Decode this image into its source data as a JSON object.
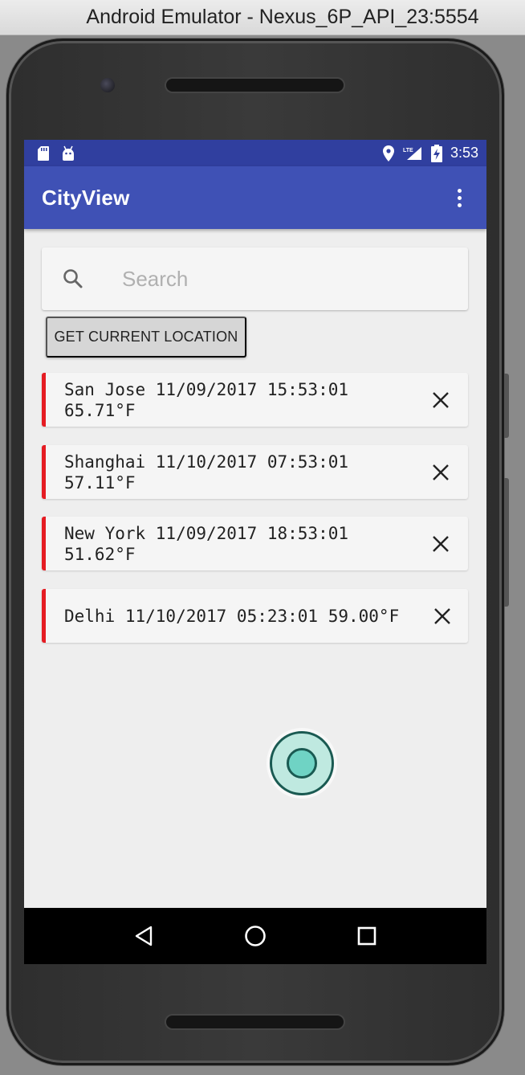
{
  "window": {
    "title": "Android Emulator - Nexus_6P_API_23:5554"
  },
  "statusbar": {
    "left_icons": [
      "sd-card-icon",
      "android-icon"
    ],
    "right_icons": [
      "location-icon",
      "lte-signal-icon",
      "battery-charging-icon"
    ],
    "time": "3:53",
    "color": "#303f9f"
  },
  "appbar": {
    "title": "CityView",
    "color": "#3f51b5",
    "menu_icon": "overflow-menu-icon"
  },
  "search": {
    "placeholder": "Search",
    "value": ""
  },
  "location_button": {
    "label": "GET CURRENT LOCATION"
  },
  "cities": [
    {
      "text": "San Jose 11/09/2017 15:53:01\n65.71°F"
    },
    {
      "text": "Shanghai 11/10/2017 07:53:01\n57.11°F"
    },
    {
      "text": "New York 11/09/2017 18:53:01\n51.62°F"
    },
    {
      "text": "Delhi 11/10/2017 05:23:01 59.00°F"
    }
  ],
  "card_accent_color": "#e51c23",
  "navbar": {
    "buttons": [
      "back-icon",
      "home-icon",
      "recents-icon"
    ]
  }
}
